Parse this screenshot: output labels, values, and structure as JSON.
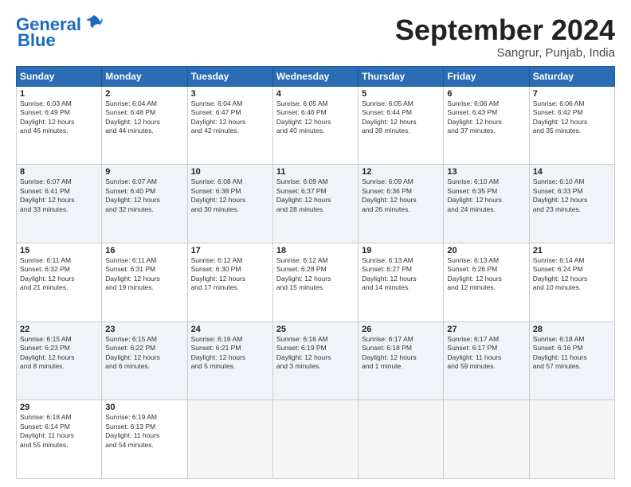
{
  "header": {
    "logo_line1": "General",
    "logo_line2": "Blue",
    "month_title": "September 2024",
    "location": "Sangrur, Punjab, India"
  },
  "days_of_week": [
    "Sunday",
    "Monday",
    "Tuesday",
    "Wednesday",
    "Thursday",
    "Friday",
    "Saturday"
  ],
  "weeks": [
    [
      {
        "day": "1",
        "info": "Sunrise: 6:03 AM\nSunset: 6:49 PM\nDaylight: 12 hours\nand 46 minutes."
      },
      {
        "day": "2",
        "info": "Sunrise: 6:04 AM\nSunset: 6:48 PM\nDaylight: 12 hours\nand 44 minutes."
      },
      {
        "day": "3",
        "info": "Sunrise: 6:04 AM\nSunset: 6:47 PM\nDaylight: 12 hours\nand 42 minutes."
      },
      {
        "day": "4",
        "info": "Sunrise: 6:05 AM\nSunset: 6:46 PM\nDaylight: 12 hours\nand 40 minutes."
      },
      {
        "day": "5",
        "info": "Sunrise: 6:05 AM\nSunset: 6:44 PM\nDaylight: 12 hours\nand 39 minutes."
      },
      {
        "day": "6",
        "info": "Sunrise: 6:06 AM\nSunset: 6:43 PM\nDaylight: 12 hours\nand 37 minutes."
      },
      {
        "day": "7",
        "info": "Sunrise: 6:06 AM\nSunset: 6:42 PM\nDaylight: 12 hours\nand 35 minutes."
      }
    ],
    [
      {
        "day": "8",
        "info": "Sunrise: 6:07 AM\nSunset: 6:41 PM\nDaylight: 12 hours\nand 33 minutes."
      },
      {
        "day": "9",
        "info": "Sunrise: 6:07 AM\nSunset: 6:40 PM\nDaylight: 12 hours\nand 32 minutes."
      },
      {
        "day": "10",
        "info": "Sunrise: 6:08 AM\nSunset: 6:38 PM\nDaylight: 12 hours\nand 30 minutes."
      },
      {
        "day": "11",
        "info": "Sunrise: 6:09 AM\nSunset: 6:37 PM\nDaylight: 12 hours\nand 28 minutes."
      },
      {
        "day": "12",
        "info": "Sunrise: 6:09 AM\nSunset: 6:36 PM\nDaylight: 12 hours\nand 26 minutes."
      },
      {
        "day": "13",
        "info": "Sunrise: 6:10 AM\nSunset: 6:35 PM\nDaylight: 12 hours\nand 24 minutes."
      },
      {
        "day": "14",
        "info": "Sunrise: 6:10 AM\nSunset: 6:33 PM\nDaylight: 12 hours\nand 23 minutes."
      }
    ],
    [
      {
        "day": "15",
        "info": "Sunrise: 6:11 AM\nSunset: 6:32 PM\nDaylight: 12 hours\nand 21 minutes."
      },
      {
        "day": "16",
        "info": "Sunrise: 6:11 AM\nSunset: 6:31 PM\nDaylight: 12 hours\nand 19 minutes."
      },
      {
        "day": "17",
        "info": "Sunrise: 6:12 AM\nSunset: 6:30 PM\nDaylight: 12 hours\nand 17 minutes."
      },
      {
        "day": "18",
        "info": "Sunrise: 6:12 AM\nSunset: 6:28 PM\nDaylight: 12 hours\nand 15 minutes."
      },
      {
        "day": "19",
        "info": "Sunrise: 6:13 AM\nSunset: 6:27 PM\nDaylight: 12 hours\nand 14 minutes."
      },
      {
        "day": "20",
        "info": "Sunrise: 6:13 AM\nSunset: 6:26 PM\nDaylight: 12 hours\nand 12 minutes."
      },
      {
        "day": "21",
        "info": "Sunrise: 6:14 AM\nSunset: 6:24 PM\nDaylight: 12 hours\nand 10 minutes."
      }
    ],
    [
      {
        "day": "22",
        "info": "Sunrise: 6:15 AM\nSunset: 6:23 PM\nDaylight: 12 hours\nand 8 minutes."
      },
      {
        "day": "23",
        "info": "Sunrise: 6:15 AM\nSunset: 6:22 PM\nDaylight: 12 hours\nand 6 minutes."
      },
      {
        "day": "24",
        "info": "Sunrise: 6:16 AM\nSunset: 6:21 PM\nDaylight: 12 hours\nand 5 minutes."
      },
      {
        "day": "25",
        "info": "Sunrise: 6:16 AM\nSunset: 6:19 PM\nDaylight: 12 hours\nand 3 minutes."
      },
      {
        "day": "26",
        "info": "Sunrise: 6:17 AM\nSunset: 6:18 PM\nDaylight: 12 hours\nand 1 minute."
      },
      {
        "day": "27",
        "info": "Sunrise: 6:17 AM\nSunset: 6:17 PM\nDaylight: 11 hours\nand 59 minutes."
      },
      {
        "day": "28",
        "info": "Sunrise: 6:18 AM\nSunset: 6:16 PM\nDaylight: 11 hours\nand 57 minutes."
      }
    ],
    [
      {
        "day": "29",
        "info": "Sunrise: 6:18 AM\nSunset: 6:14 PM\nDaylight: 11 hours\nand 55 minutes."
      },
      {
        "day": "30",
        "info": "Sunrise: 6:19 AM\nSunset: 6:13 PM\nDaylight: 11 hours\nand 54 minutes."
      },
      {
        "day": "",
        "info": ""
      },
      {
        "day": "",
        "info": ""
      },
      {
        "day": "",
        "info": ""
      },
      {
        "day": "",
        "info": ""
      },
      {
        "day": "",
        "info": ""
      }
    ]
  ]
}
